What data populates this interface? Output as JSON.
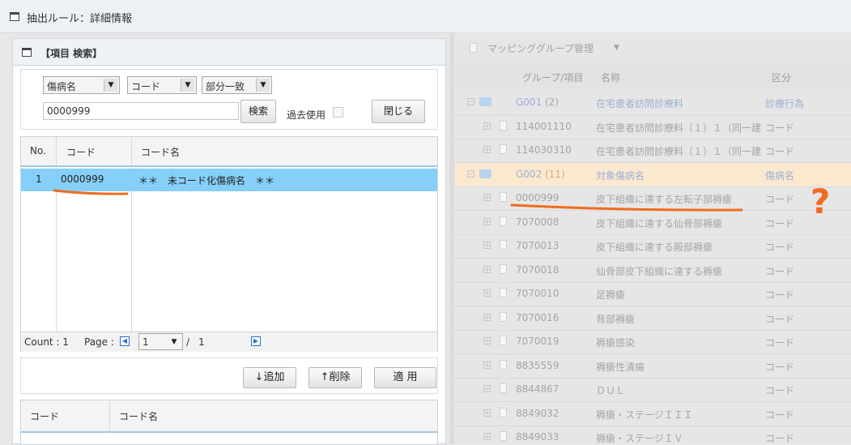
{
  "window": {
    "title": "抽出ルール：詳細情報"
  },
  "search_panel": {
    "title": "【項目 検索】",
    "category_select": "傷病名",
    "field_select": "コード",
    "match_select": "部分一致",
    "keyword_value": "0000999",
    "search_button": "検索",
    "past_use_label": "過去使用",
    "close_button": "閉じる"
  },
  "result_grid": {
    "headers": {
      "no": "No.",
      "code": "コード",
      "name": "コード名"
    },
    "rows": [
      {
        "no": "1",
        "code": "0000999",
        "name": "＊＊　未コード化傷病名　＊＊"
      }
    ],
    "footer": {
      "count": "Count : 1",
      "page_label": "Page :",
      "page_value": "1",
      "separator": "/",
      "total": "1"
    }
  },
  "actions": {
    "add": "↓追加",
    "delete": "↑削除",
    "apply": "適 用"
  },
  "selected_grid": {
    "headers": {
      "code": "コード",
      "name": "コード名"
    }
  },
  "mapping_panel": {
    "toolbar_title": "マッピンググループ管理",
    "headers": {
      "group": "グループ/項目",
      "name": "名称",
      "kubun": "区分"
    },
    "rows": [
      {
        "type": "group",
        "code": "G001",
        "count": "(2)",
        "name": "在宅患者訪問診療料",
        "kubun": "診療行為"
      },
      {
        "type": "item",
        "code": "114001110",
        "name": "在宅患者訪問診療料（１）１（同一建",
        "kubun": "コード"
      },
      {
        "type": "item",
        "code": "114030310",
        "name": "在宅患者訪問診療料（１）１（同一建",
        "kubun": "コード"
      },
      {
        "type": "group",
        "code": "G002",
        "count": "(11)",
        "name": "対象傷病名",
        "kubun": "傷病名"
      },
      {
        "type": "item",
        "code": "0000999",
        "name": "皮下組織に達する左転子部褥瘡",
        "kubun": "コード"
      },
      {
        "type": "item",
        "code": "7070008",
        "name": "皮下組織に達する仙骨部褥瘡",
        "kubun": "コード"
      },
      {
        "type": "item",
        "code": "7070013",
        "name": "皮下組織に達する殿部褥瘡",
        "kubun": "コード"
      },
      {
        "type": "item",
        "code": "7070018",
        "name": "仙骨部皮下組織に達する褥瘡",
        "kubun": "コード"
      },
      {
        "type": "item",
        "code": "7070010",
        "name": "足褥瘡",
        "kubun": "コード"
      },
      {
        "type": "item",
        "code": "7070016",
        "name": "背部褥瘡",
        "kubun": "コード"
      },
      {
        "type": "item",
        "code": "7070019",
        "name": "褥瘡感染",
        "kubun": "コード"
      },
      {
        "type": "item",
        "code": "8835559",
        "name": "褥瘡性潰瘍",
        "kubun": "コード"
      },
      {
        "type": "item",
        "code": "8844867",
        "name": "ＤＵＬ",
        "kubun": "コード"
      },
      {
        "type": "item",
        "code": "8849032",
        "name": "褥瘡・ステージＩＩＩ",
        "kubun": "コード"
      },
      {
        "type": "item",
        "code": "8849033",
        "name": "褥瘡・ステージＩＶ",
        "kubun": "コード"
      }
    ]
  },
  "annotation": {
    "question_mark": "?",
    "color": "#f06b21"
  }
}
